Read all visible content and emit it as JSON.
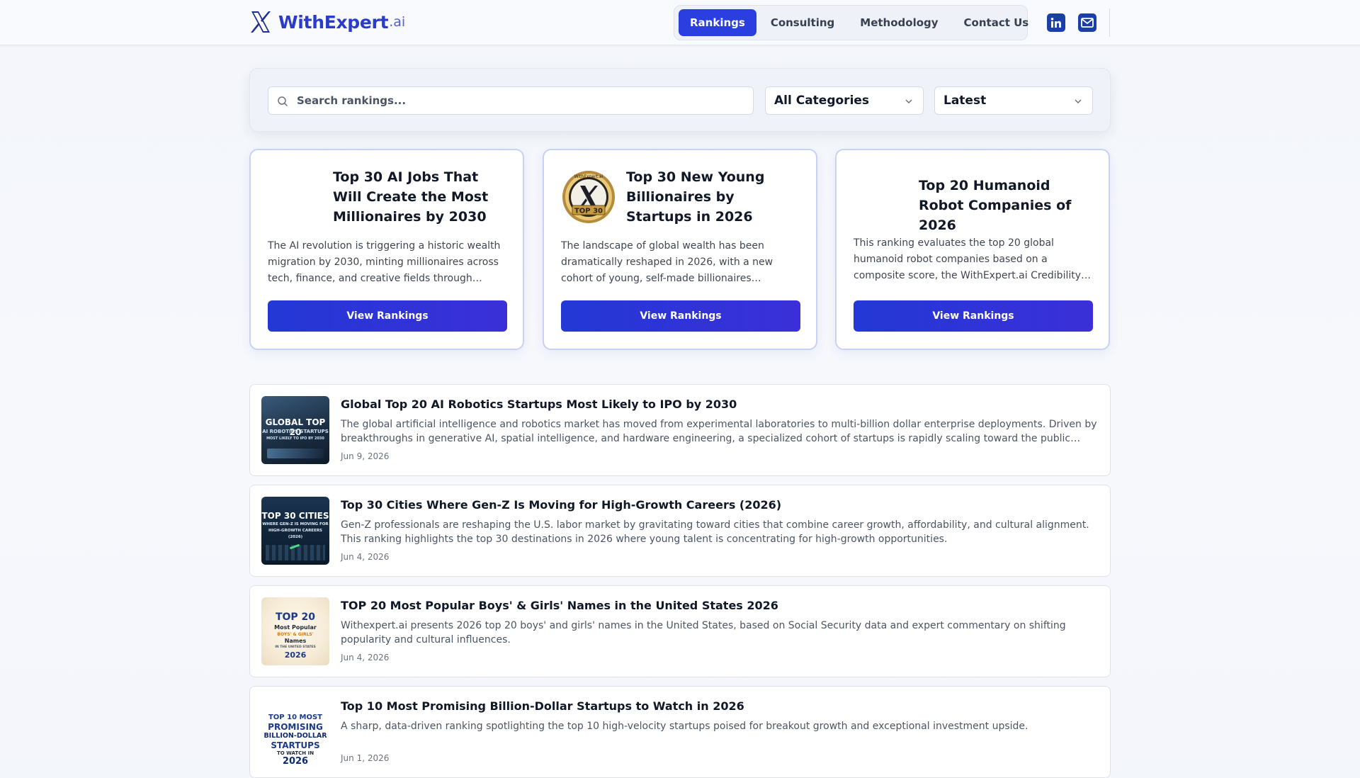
{
  "header": {
    "brand": "WithExpert",
    "brand_suffix": ".ai",
    "nav": [
      "Rankings",
      "Consulting",
      "Methodology",
      "Contact Us"
    ],
    "active_nav": "Rankings",
    "social": [
      "linkedin-icon",
      "mail-icon"
    ]
  },
  "filters": {
    "search_placeholder": "Search rankings...",
    "category": "All Categories",
    "sort": "Latest"
  },
  "featured": [
    {
      "title": "Top 30 AI Jobs That Will Create the Most Millionaires by 2030",
      "description": "The AI revolution is triggering a historic wealth migration by 2030, minting millionaires across tech, finance, and creative fields through…",
      "button": "View Rankings"
    },
    {
      "title": "Top 30 New Young Billionaires by Startups in 2026",
      "description": "The landscape of global wealth has been dramatically reshaped in 2026, with a new cohort of young, self-made billionaires…",
      "button": "View Rankings",
      "badge_text": "TOP 30",
      "badge_ring": "WithExpert.ai"
    },
    {
      "title": "Top 20 Humanoid Robot Companies of 2026",
      "description": "This ranking evaluates the top 20 global humanoid robot companies based on a composite score, the WithExpert.ai Credibility…",
      "button": "View Rankings"
    }
  ],
  "rankings": [
    {
      "title": "Global Top 20 AI Robotics Startups Most Likely to IPO by 2030",
      "description": "The global artificial intelligence and robotics market has moved from experimental laboratories to multi-billion dollar enterprise deployments. Driven by breakthroughs in generative AI, spatial intelligence, and hardware engineering, a specialized cohort of startups is rapidly scaling toward the public…",
      "date": "Jun 9, 2026",
      "thumb_lines": [
        "GLOBAL TOP 20",
        "AI ROBOTICS STARTUPS",
        "MOST LIKELY TO IPO BY 2030"
      ]
    },
    {
      "title": "Top 30 Cities Where Gen-Z Is Moving for High-Growth Careers (2026)",
      "description": "Gen-Z professionals are reshaping the U.S. labor market by gravitating toward cities that combine career growth, affordability, and cultural alignment. This ranking highlights the top 30 destinations in 2026 where young talent is concentrating for high-growth opportunities.",
      "date": "Jun 4, 2026",
      "thumb_lines": [
        "TOP 30 CITIES",
        "WHERE GEN-Z IS MOVING FOR",
        "HIGH-GROWTH CAREERS",
        "(2026)"
      ]
    },
    {
      "title": "TOP 20 Most Popular Boys' & Girls' Names in the United States 2026",
      "description": "Withexpert.ai presents 2026 top 20 boys' and girls' names in the United States, based on Social Security data and expert commentary on shifting popularity and cultural influences.",
      "date": "Jun 4, 2026",
      "thumb_lines": [
        "TOP 20",
        "Most Popular",
        "BOYS' & GIRLS'",
        "Names",
        "IN THE UNITED STATES",
        "2026"
      ]
    },
    {
      "title": "Top 10 Most Promising Billion-Dollar Startups to Watch in 2026",
      "description": "A sharp, data-driven ranking spotlighting the top 10 high-velocity startups poised for breakout growth and exceptional investment upside.",
      "date": "Jun 1, 2026",
      "thumb_lines": [
        "TOP 10 MOST",
        "PROMISING",
        "BILLION-DOLLAR",
        "STARTUPS",
        "TO WATCH IN",
        "2026"
      ]
    }
  ],
  "colors": {
    "brand": "#2a3cc9",
    "accent": "#2b3fe0",
    "card_border": "#c7d2f5"
  }
}
